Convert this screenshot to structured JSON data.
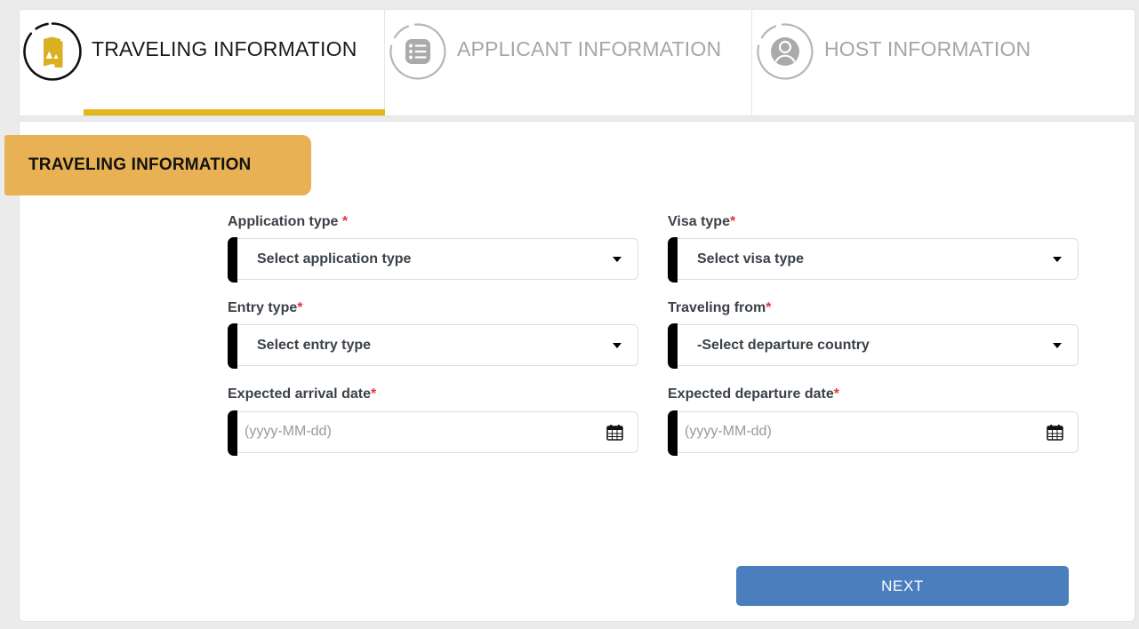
{
  "tabs": [
    {
      "label": "TRAVELING INFORMATION",
      "icon": "brochure-icon",
      "state": "active"
    },
    {
      "label": "APPLICANT INFORMATION",
      "icon": "form-list-icon",
      "state": "inactive"
    },
    {
      "label": "HOST INFORMATION",
      "icon": "user-icon",
      "state": "inactive"
    }
  ],
  "section": {
    "banner_title": "TRAVELING INFORMATION"
  },
  "form": {
    "rows": [
      [
        {
          "label": "Application type ",
          "required": "*",
          "type": "select",
          "value": "Select application type",
          "icon": "chevron-down-icon"
        },
        {
          "label": "Visa type",
          "required": "*",
          "type": "select",
          "value": "Select visa type",
          "icon": "chevron-down-icon"
        }
      ],
      [
        {
          "label": "Entry type",
          "required": "*",
          "type": "select",
          "value": "Select entry type",
          "icon": "chevron-down-icon"
        },
        {
          "label": "Traveling from",
          "required": "*",
          "type": "select",
          "value": "-Select departure country",
          "icon": "chevron-down-icon"
        }
      ],
      [
        {
          "label": "Expected arrival date",
          "required": "*",
          "type": "date",
          "value": "(yyyy-MM-dd)",
          "icon": "calendar-icon"
        },
        {
          "label": "Expected departure date",
          "required": "*",
          "type": "date",
          "value": "(yyyy-MM-dd)",
          "icon": "calendar-icon"
        }
      ]
    ]
  },
  "actions": {
    "next_label": "NEXT"
  },
  "colors": {
    "accent_yellow": "#e3b61e",
    "banner_yellow": "#e8b254",
    "required_red": "#e0393e",
    "next_blue": "#4a7ebc",
    "inactive_gray": "#a6a6a6"
  }
}
